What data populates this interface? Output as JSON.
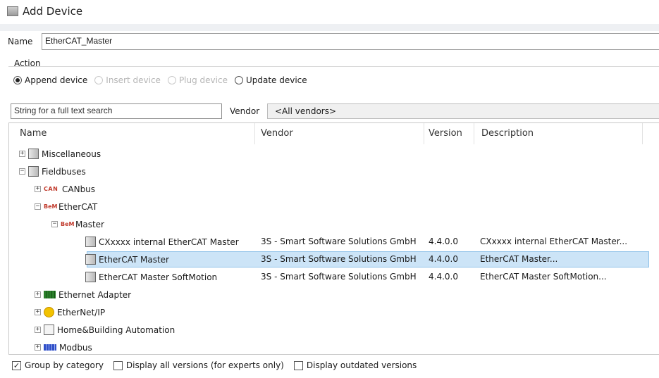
{
  "window": {
    "title": "Add Device"
  },
  "name_field": {
    "label": "Name",
    "value": "EtherCAT_Master"
  },
  "action": {
    "label": "Action",
    "options": [
      {
        "label": "Append device",
        "checked": true,
        "enabled": true
      },
      {
        "label": "Insert device",
        "checked": false,
        "enabled": false
      },
      {
        "label": "Plug device",
        "checked": false,
        "enabled": false
      },
      {
        "label": "Update device",
        "checked": false,
        "enabled": true
      }
    ]
  },
  "search": {
    "placeholder": "String for a full text search"
  },
  "vendor": {
    "label": "Vendor",
    "value": "<All vendors>"
  },
  "table": {
    "columns": [
      "Name",
      "Vendor",
      "Version",
      "Description"
    ],
    "rows": [
      {
        "name": "Miscellaneous",
        "vendor": "",
        "version": "",
        "description": ""
      },
      {
        "name": "Fieldbuses",
        "vendor": "",
        "version": "",
        "description": ""
      },
      {
        "name": "CANbus",
        "vendor": "",
        "version": "",
        "description": ""
      },
      {
        "name": "EtherCAT",
        "vendor": "",
        "version": "",
        "description": ""
      },
      {
        "name": "Master",
        "vendor": "",
        "version": "",
        "description": ""
      },
      {
        "name": "CXxxxx internal EtherCAT Master",
        "vendor": "3S - Smart Software Solutions GmbH",
        "version": "4.4.0.0",
        "description": "CXxxxx internal EtherCAT Master..."
      },
      {
        "name": "EtherCAT Master",
        "vendor": "3S - Smart Software Solutions GmbH",
        "version": "4.4.0.0",
        "description": "EtherCAT Master...",
        "selected": true
      },
      {
        "name": "EtherCAT Master SoftMotion",
        "vendor": "3S - Smart Software Solutions GmbH",
        "version": "4.4.0.0",
        "description": "EtherCAT Master SoftMotion..."
      },
      {
        "name": "Ethernet Adapter",
        "vendor": "",
        "version": "",
        "description": ""
      },
      {
        "name": "EtherNet/IP",
        "vendor": "",
        "version": "",
        "description": ""
      },
      {
        "name": "Home&Building Automation",
        "vendor": "",
        "version": "",
        "description": ""
      },
      {
        "name": "Modbus",
        "vendor": "",
        "version": "",
        "description": ""
      }
    ],
    "icons": {
      "can_text": "CAN",
      "ecat_text": "BeM"
    }
  },
  "options": [
    {
      "label": "Group by category",
      "checked": true
    },
    {
      "label": "Display all versions (for experts only)",
      "checked": false
    },
    {
      "label": "Display outdated versions",
      "checked": false
    }
  ],
  "colors": {
    "selection": "#cce4f7",
    "selection_border": "#8ec1e8"
  }
}
